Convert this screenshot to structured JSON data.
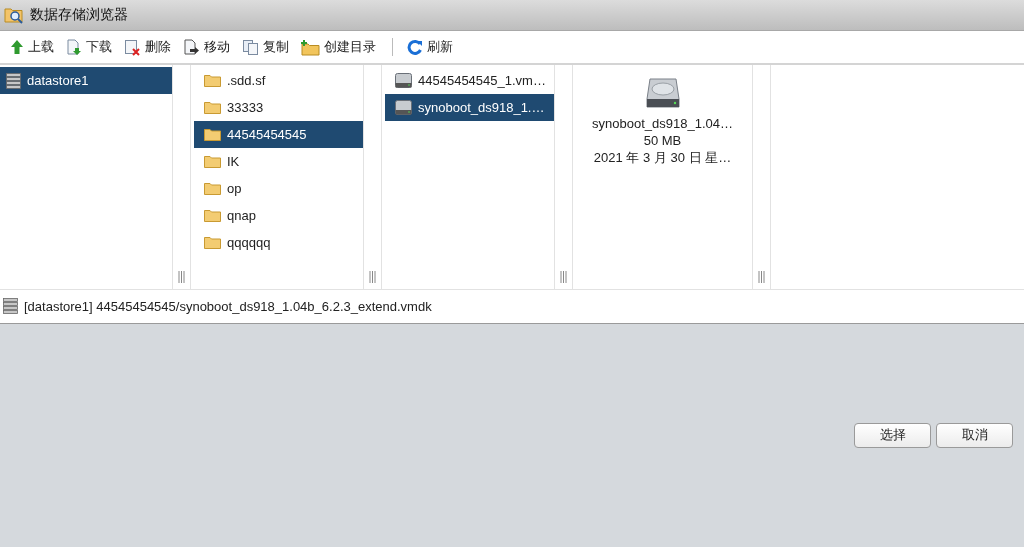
{
  "window": {
    "title": "数据存储浏览器"
  },
  "toolbar": [
    {
      "kind": "upload",
      "label": "上载"
    },
    {
      "kind": "download",
      "label": "下载"
    },
    {
      "kind": "delete",
      "label": "删除"
    },
    {
      "kind": "move",
      "label": "移动"
    },
    {
      "kind": "copy",
      "label": "复制"
    },
    {
      "kind": "newfolder",
      "label": "创建目录"
    },
    {
      "kind": "refresh",
      "label": "刷新"
    }
  ],
  "columns": [
    {
      "items": [
        {
          "kind": "datastore",
          "name": "datastore1",
          "selected": true
        }
      ]
    },
    {
      "items": [
        {
          "kind": "folder",
          "name": ".sdd.sf",
          "selected": false
        },
        {
          "kind": "folder",
          "name": "33333",
          "selected": false
        },
        {
          "kind": "folder",
          "name": "44545454545",
          "selected": true
        },
        {
          "kind": "folder",
          "name": "IK",
          "selected": false
        },
        {
          "kind": "folder",
          "name": "op",
          "selected": false
        },
        {
          "kind": "folder",
          "name": "qnap",
          "selected": false
        },
        {
          "kind": "folder",
          "name": "qqqqqq",
          "selected": false
        }
      ]
    },
    {
      "items": [
        {
          "kind": "disk",
          "name": "44545454545_1.vm…",
          "selected": false
        },
        {
          "kind": "disk",
          "name": "synoboot_ds918_1.…",
          "selected": true
        }
      ]
    }
  ],
  "details": {
    "name": "synoboot_ds918_1.04…",
    "size": "50 MB",
    "date": "2021 年 3 月 30 日 星…"
  },
  "path": "[datastore1] 44545454545/synoboot_ds918_1.04b_6.2.3_extend.vmdk",
  "buttons": [
    "选择",
    "取消"
  ]
}
